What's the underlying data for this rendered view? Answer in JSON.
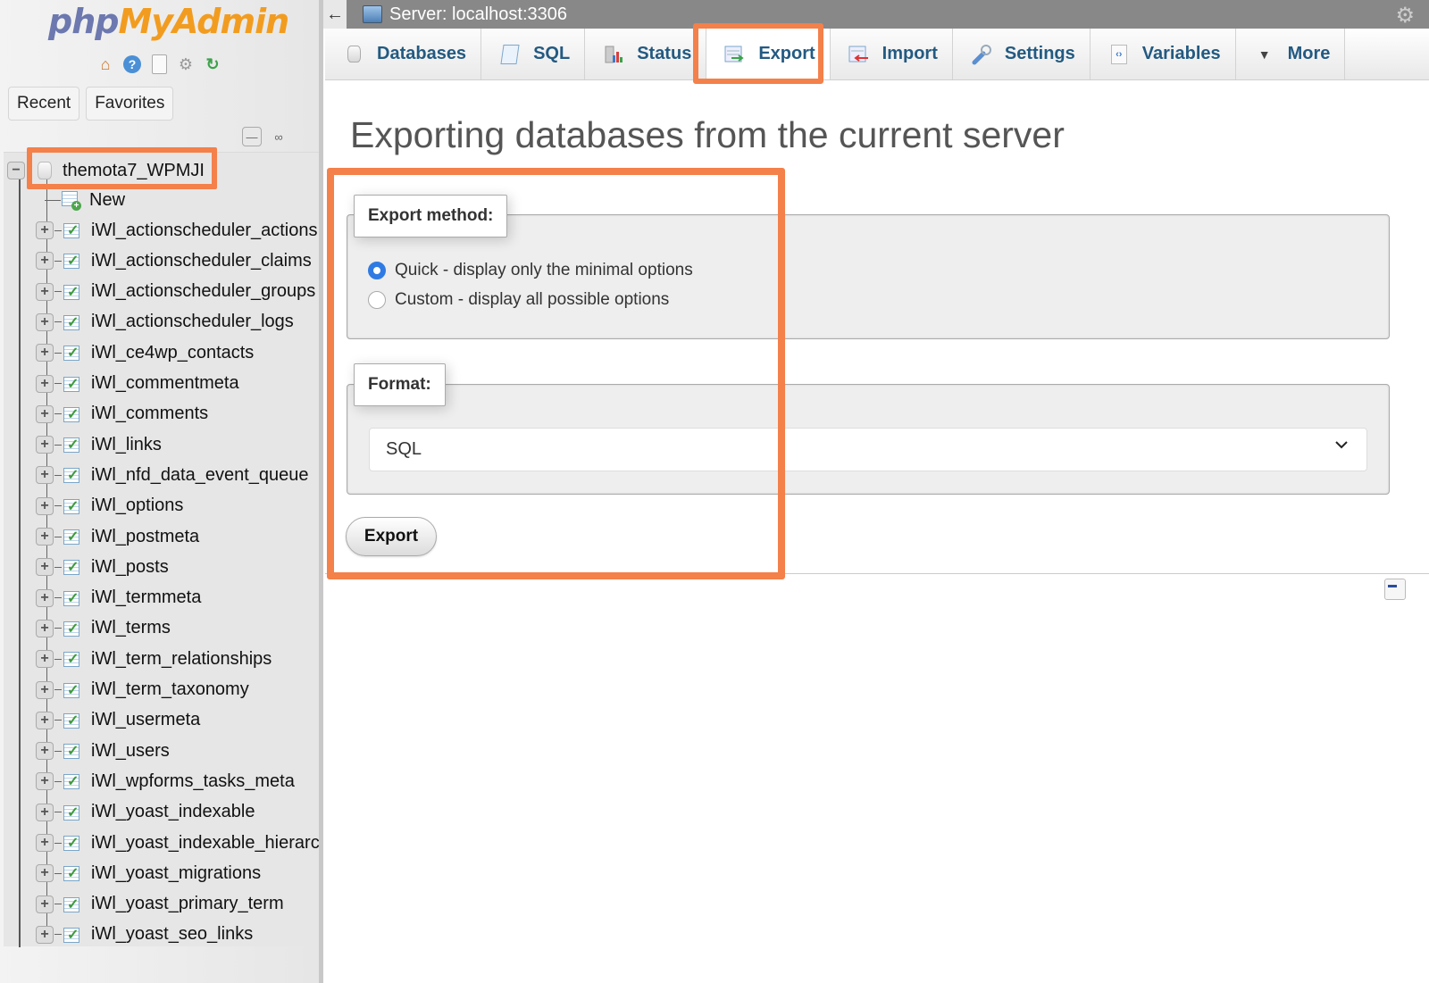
{
  "sidebar": {
    "logo": {
      "part1": "php",
      "part2": "MyAdmin"
    },
    "quick_icons": [
      "home-icon",
      "help-icon",
      "docs-icon",
      "settings-icon",
      "reload-icon"
    ],
    "tabs": [
      {
        "label": "Recent"
      },
      {
        "label": "Favorites"
      }
    ],
    "database": {
      "name": "themota7_WPMJI",
      "expanded": true
    },
    "new_label": "New",
    "tables": [
      "iWl_actionscheduler_actions",
      "iWl_actionscheduler_claims",
      "iWl_actionscheduler_groups",
      "iWl_actionscheduler_logs",
      "iWl_ce4wp_contacts",
      "iWl_commentmeta",
      "iWl_comments",
      "iWl_links",
      "iWl_nfd_data_event_queue",
      "iWl_options",
      "iWl_postmeta",
      "iWl_posts",
      "iWl_termmeta",
      "iWl_terms",
      "iWl_term_relationships",
      "iWl_term_taxonomy",
      "iWl_usermeta",
      "iWl_users",
      "iWl_wpforms_tasks_meta",
      "iWl_yoast_indexable",
      "iWl_yoast_indexable_hierarchy",
      "iWl_yoast_migrations",
      "iWl_yoast_primary_term",
      "iWl_yoast_seo_links"
    ]
  },
  "topbar": {
    "back": "←",
    "server_label": "Server: localhost:3306"
  },
  "tabs": [
    {
      "label": "Databases",
      "icon": "database-icon",
      "active": false
    },
    {
      "label": "SQL",
      "icon": "sql-icon",
      "active": false
    },
    {
      "label": "Status",
      "icon": "status-icon",
      "active": false
    },
    {
      "label": "Export",
      "icon": "export-icon",
      "active": true
    },
    {
      "label": "Import",
      "icon": "import-icon",
      "active": false
    },
    {
      "label": "Settings",
      "icon": "settings-icon",
      "active": false
    },
    {
      "label": "Variables",
      "icon": "variables-icon",
      "active": false
    },
    {
      "label": "More",
      "icon": "caret-down-icon",
      "active": false
    }
  ],
  "main": {
    "title": "Exporting databases from the current server",
    "method_legend": "Export method:",
    "methods": [
      {
        "label": "Quick - display only the minimal options",
        "checked": true
      },
      {
        "label": "Custom - display all possible options",
        "checked": false
      }
    ],
    "format_legend": "Format:",
    "format_selected": "SQL",
    "export_button": "Export"
  },
  "colors": {
    "highlight": "#f4804a",
    "tab_text": "#235a81",
    "radio_checked": "#2f7be3"
  }
}
